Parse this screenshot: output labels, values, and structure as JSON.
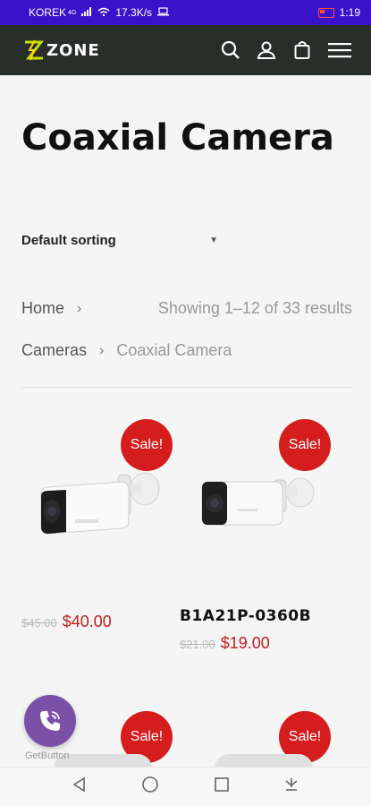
{
  "status_bar": {
    "carrier": "KOREK",
    "network_type": "4G",
    "data_speed": "17.3K/s",
    "time": "1:19"
  },
  "header": {
    "logo_text": "ZONE",
    "icons": [
      "search-icon",
      "account-icon",
      "cart-icon",
      "menu-icon"
    ]
  },
  "page": {
    "title": "Coaxial Camera",
    "sorting": "Default sorting",
    "breadcrumb": {
      "home": "Home",
      "category": "Cameras",
      "current": "Coaxial Camera",
      "separator": "›"
    },
    "results": "Showing 1–12 of 33 results"
  },
  "products": [
    {
      "badge": "Sale!",
      "name": "",
      "old_price": "$45.00",
      "new_price": "$40.00"
    },
    {
      "badge": "Sale!",
      "name": "B1A21P-0360B",
      "old_price": "$21.00",
      "new_price": "$19.00"
    },
    {
      "badge": "Sale!"
    },
    {
      "badge": "Sale!"
    }
  ],
  "float_button": {
    "label": "GetButton"
  },
  "colors": {
    "status_bar": "#3a12c9",
    "header": "#2a2e2b",
    "sale_badge": "#d51d1d",
    "price": "#c41c1c",
    "viber": "#7b51a8",
    "logo_accent": "#c7e000"
  }
}
